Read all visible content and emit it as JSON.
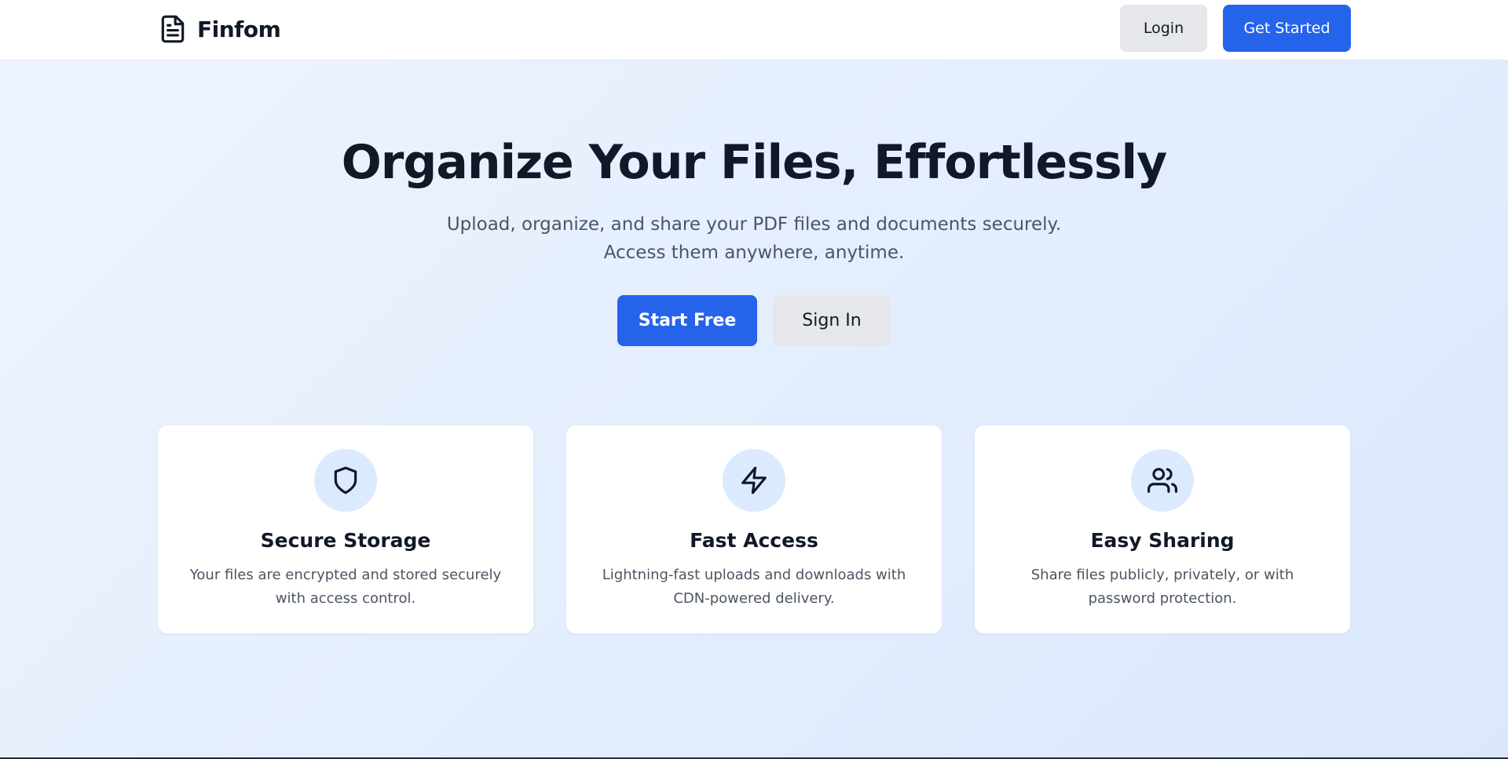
{
  "header": {
    "brand": "Finfom",
    "logo_icon": "file-text-icon",
    "login_label": "Login",
    "get_started_label": "Get Started"
  },
  "hero": {
    "title": "Organize Your Files, Effortlessly",
    "subtitle": "Upload, organize, and share your PDF files and documents securely. Access them anywhere, anytime.",
    "start_free_label": "Start Free",
    "sign_in_label": "Sign In"
  },
  "features": [
    {
      "icon": "shield-icon",
      "title": "Secure Storage",
      "description": "Your files are encrypted and stored securely with access control."
    },
    {
      "icon": "lightning-bolt-icon",
      "title": "Fast Access",
      "description": "Lightning-fast uploads and downloads with CDN-powered delivery."
    },
    {
      "icon": "users-icon",
      "title": "Easy Sharing",
      "description": "Share files publicly, privately, or with password protection."
    }
  ],
  "colors": {
    "primary": "#2563eb",
    "secondary_button": "#e5e7eb",
    "heading": "#111827",
    "body_text": "#4b5563",
    "icon_circle": "#dbeafe",
    "background": "#e6effd"
  }
}
